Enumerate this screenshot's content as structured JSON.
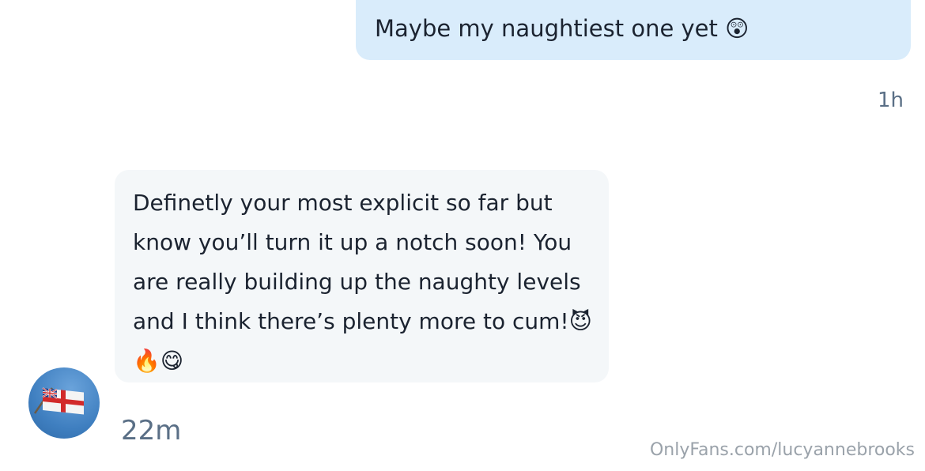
{
  "conversation": {
    "outgoing": {
      "text": "Maybe my naughtiest one yet 😲",
      "timestamp": "1h"
    },
    "incoming": {
      "lines": [
        "Definetly your most explicit so far but",
        "know you’ll turn it up a notch soon! You",
        "are really building up the naughty levels",
        "and I think there’s plenty more to cum!😈",
        "🔥😋"
      ],
      "timestamp": "22m",
      "avatar_icon": "flag-avatar-icon"
    }
  },
  "watermark": {
    "text": "OnlyFans.com/lucyannebrooks"
  },
  "colors": {
    "outgoing_bubble": "#d9ecfb",
    "incoming_bubble": "#f4f7f9",
    "timestamp": "#5a6f86",
    "text": "#1b2330",
    "watermark": "#9aa2aa"
  }
}
